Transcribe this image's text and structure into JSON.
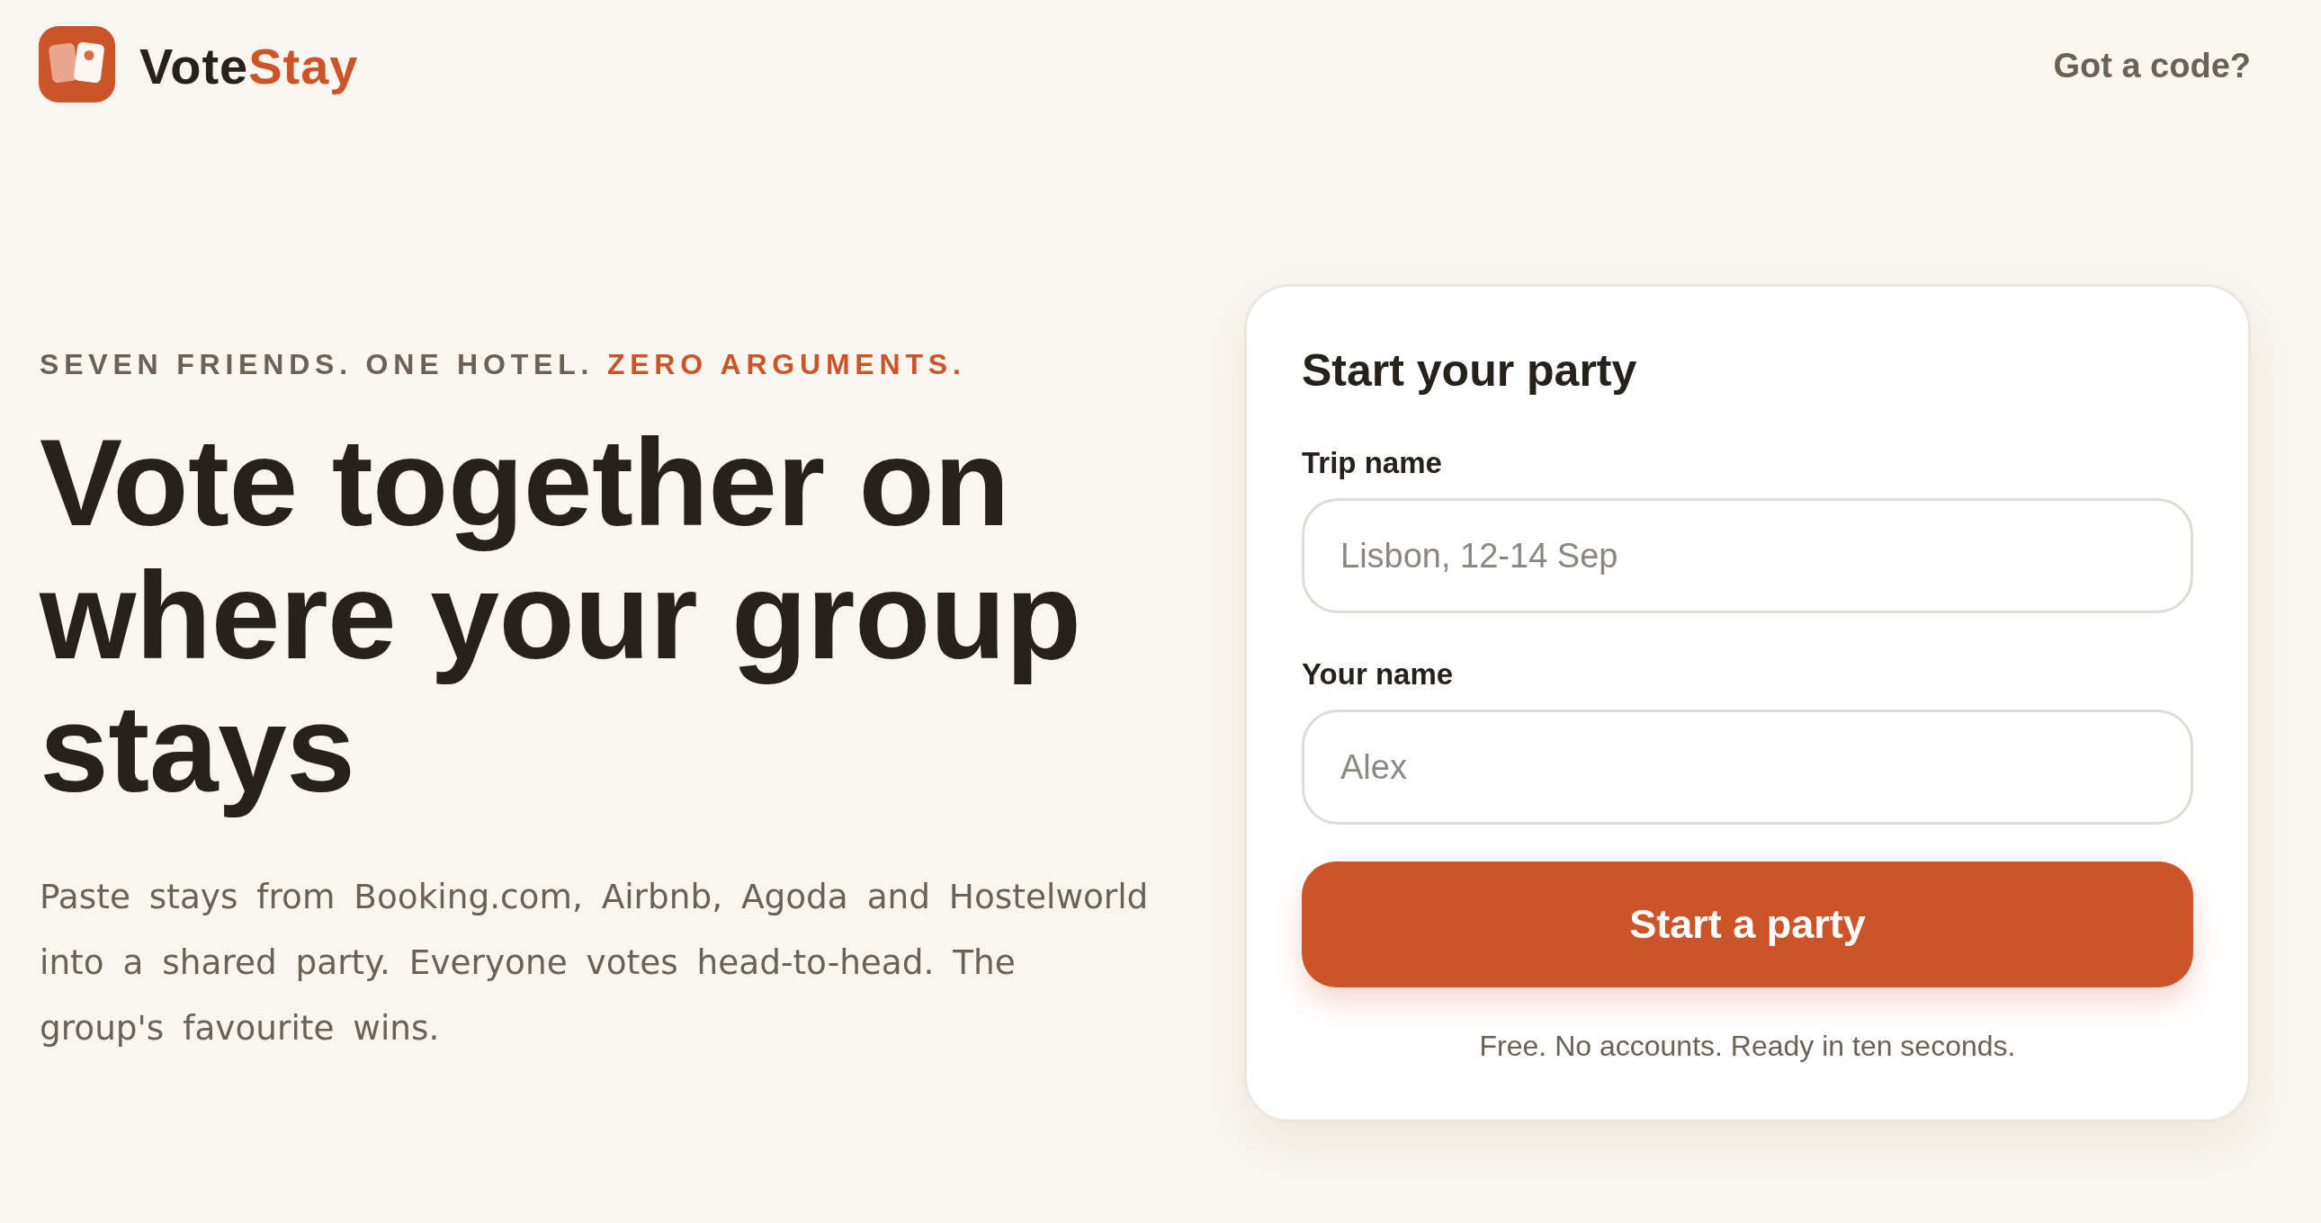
{
  "header": {
    "brand": {
      "parts": [
        {
          "text": "Vote",
          "accent": false
        },
        {
          "text": "Stay",
          "accent": true
        }
      ]
    },
    "link": "Got a code?"
  },
  "hero": {
    "tagline": {
      "parts": [
        {
          "text": "SEVEN FRIENDS. ONE HOTEL.",
          "accent": false
        },
        {
          "text": "ZERO ARGUMENTS.",
          "accent": true
        }
      ]
    },
    "headline": "Vote together on where your group stays",
    "description": "Paste stays from Booking.com, Airbnb, Agoda and Hostelworld into a shared party. Everyone votes head-to-head. The group's favourite wins."
  },
  "form": {
    "title": "Start your party",
    "fields": [
      {
        "label": "Trip name",
        "placeholder": "Lisbon, 12-14 Sep"
      },
      {
        "label": "Your name",
        "placeholder": "Alex"
      }
    ],
    "submit": "Start a party",
    "note": "Free. No accounts. Ready in ten seconds."
  }
}
